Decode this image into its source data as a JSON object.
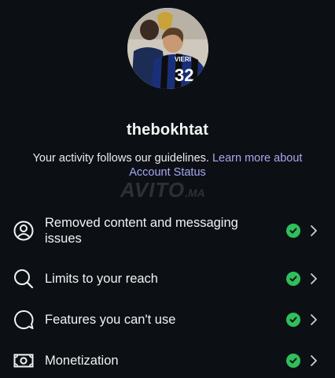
{
  "profile": {
    "username": "thebokhtat"
  },
  "status": {
    "text": "Your activity follows our guidelines. ",
    "link": "Learn more about Account Status"
  },
  "watermark": {
    "brand": "AVITO",
    "suffix": ".MA"
  },
  "items": [
    {
      "label": "Removed content and messaging issues",
      "icon": "person-circle-icon",
      "status": "ok"
    },
    {
      "label": "Limits to your reach",
      "icon": "search-icon",
      "status": "ok"
    },
    {
      "label": "Features you can't use",
      "icon": "chat-bubble-icon",
      "status": "ok"
    },
    {
      "label": "Monetization",
      "icon": "money-icon",
      "status": "ok"
    }
  ],
  "colors": {
    "background": "#0c1014",
    "link": "#a8a6f3",
    "ok": "#2fbf5b"
  }
}
